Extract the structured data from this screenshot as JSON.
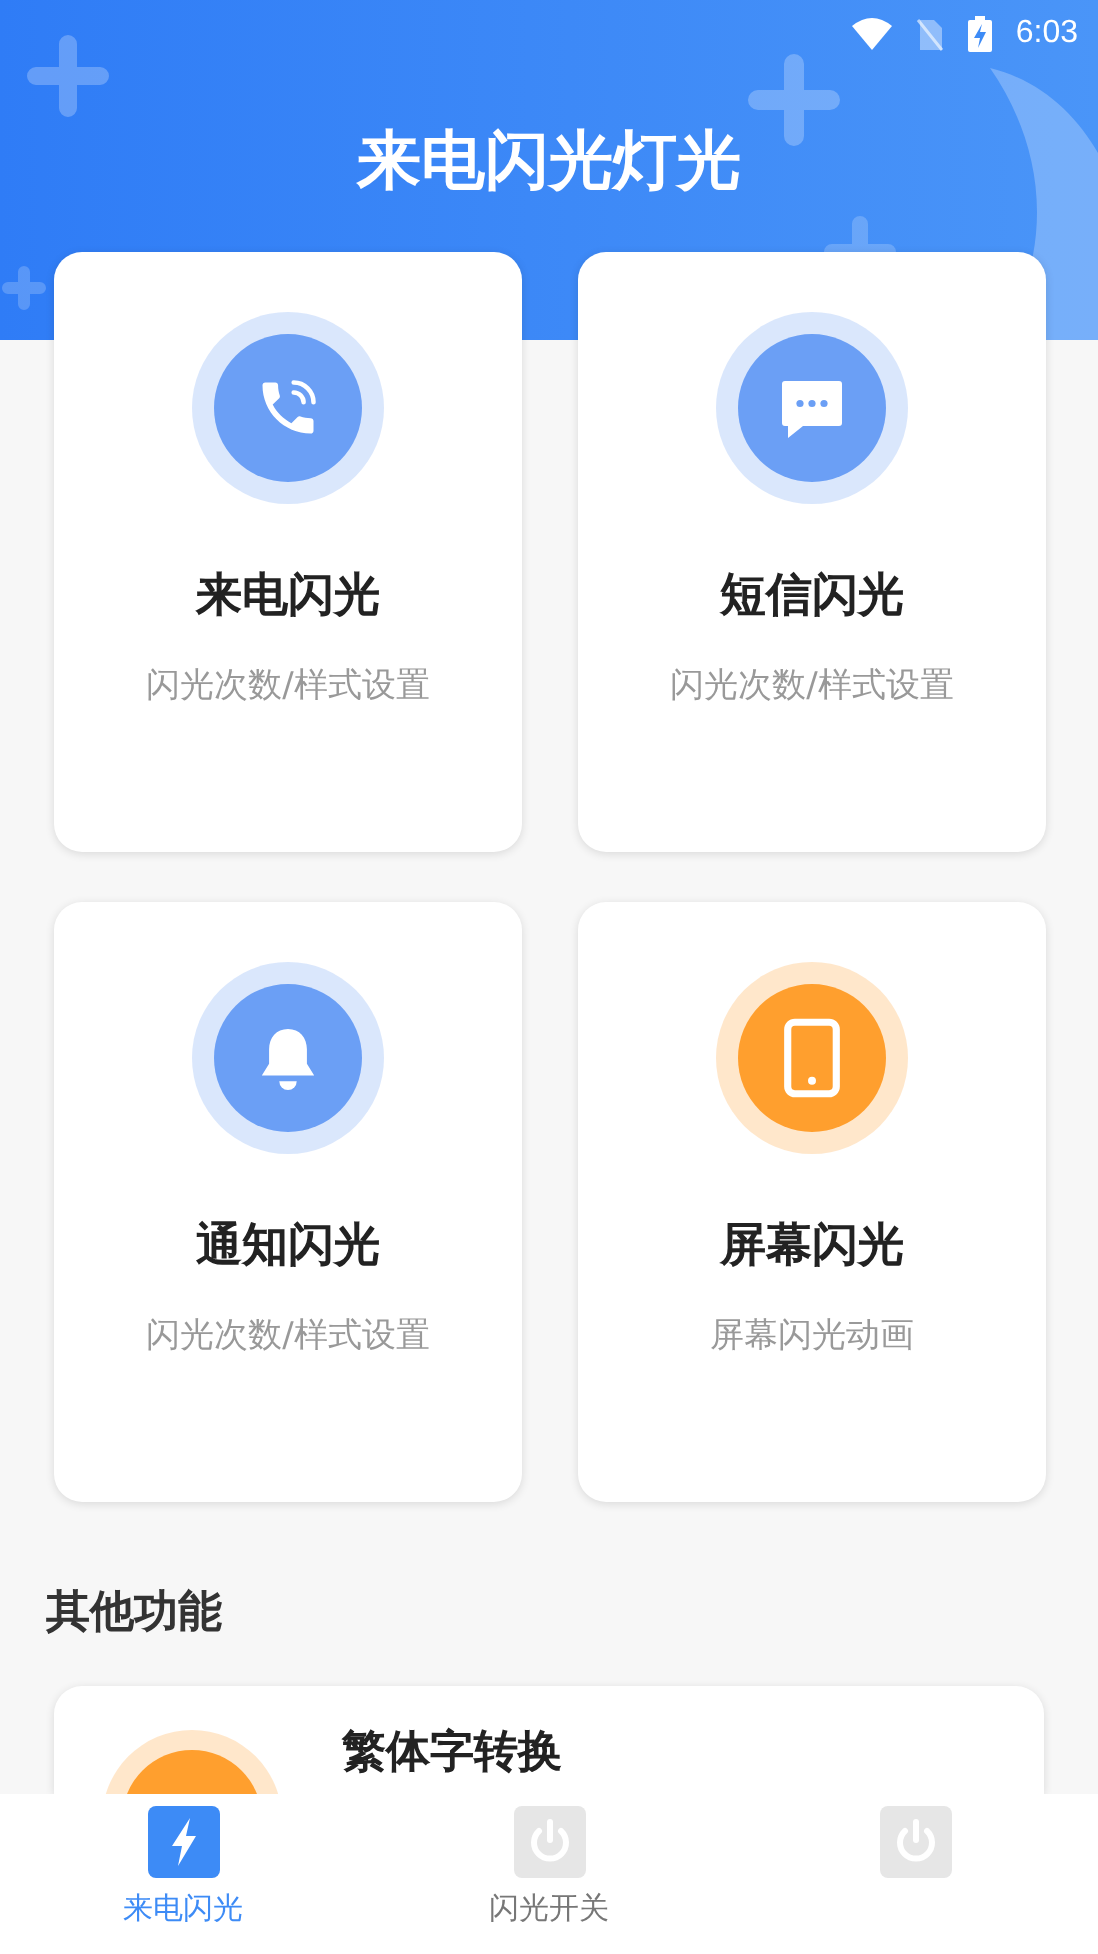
{
  "status_bar": {
    "time": "6:03"
  },
  "title": "来电闪光灯光",
  "cards": [
    {
      "kind": "phone",
      "color": "#6b9ff5",
      "title": "来电闪光",
      "subtitle": "闪光次数/样式设置"
    },
    {
      "kind": "message",
      "color": "#6b9ff5",
      "title": "短信闪光",
      "subtitle": "闪光次数/样式设置"
    },
    {
      "kind": "bell",
      "color": "#6b9ff5",
      "title": "通知闪光",
      "subtitle": "闪光次数/样式设置"
    },
    {
      "kind": "tablet",
      "color": "#ff9f2e",
      "title": "屏幕闪光",
      "subtitle": "屏幕闪光动画"
    }
  ],
  "section_title": "其他功能",
  "other_items": [
    {
      "color": "#ff9f2e",
      "title": "繁体字转换"
    }
  ],
  "tabs": [
    {
      "kind": "bolt",
      "label": "来电闪光",
      "selected": true
    },
    {
      "kind": "power",
      "label": "闪光开关",
      "selected": false
    },
    {
      "kind": "power",
      "selected": false
    }
  ]
}
